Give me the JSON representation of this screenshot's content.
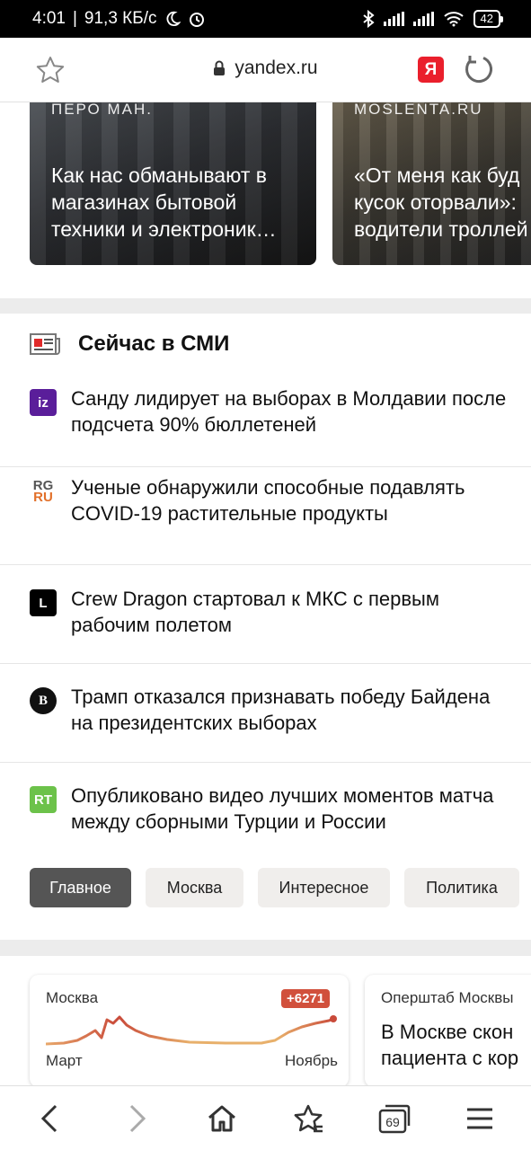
{
  "status_bar": {
    "time": "4:01",
    "speed": "91,3 КБ/с",
    "battery": "42"
  },
  "browser": {
    "url": "yandex.ru",
    "yandex_badge": "Я",
    "tab_count": "69"
  },
  "top_cards": [
    {
      "source": "ПЕРО МАН.",
      "title": "Как нас обманывают в\nмагазинах бытовой\nтехники и электроник…"
    },
    {
      "source": "MOSLENTA.RU",
      "title": "«От меня как буд\nкусок оторвали»:\nводители троллей"
    }
  ],
  "news": {
    "heading": "Сейчас в СМИ",
    "items": [
      {
        "source_icon": "izvestia-logo-icon",
        "source_label": "iz",
        "text": "Санду лидирует на выборах в Молдавии после подсчета 90% бюллетеней"
      },
      {
        "source_icon": "rg-logo-icon",
        "source_label": "RG RU",
        "text": "Ученые обнаружили способные подавлять COVID-19 растительные продукты"
      },
      {
        "source_icon": "l-logo-icon",
        "source_label": "L",
        "text": "Crew Dragon стартовал к МКС с первым рабочим полетом"
      },
      {
        "source_icon": "vedomosti-logo-icon",
        "source_label": "B",
        "text": "Трамп отказался признавать победу Байдена на президентских выборах"
      },
      {
        "source_icon": "rt-logo-icon",
        "source_label": "RT",
        "text": "Опубликовано видео лучших моментов матча между сборными Турции и России"
      }
    ],
    "tabs": [
      {
        "label": "Главное",
        "active": true
      },
      {
        "label": "Москва",
        "active": false
      },
      {
        "label": "Интересное",
        "active": false
      },
      {
        "label": "Политика",
        "active": false
      }
    ]
  },
  "widgets": {
    "covid": {
      "city": "Москва",
      "delta": "+6271",
      "start_month": "Март",
      "end_month": "Ноябрь"
    },
    "news2": {
      "source": "Оперштаб Москвы",
      "text": "В Москве скон\nпациента с кор"
    }
  },
  "colors": {
    "accent_red": "#ea1f2c",
    "badge_red": "#d1503c",
    "tab_active": "#555555"
  }
}
